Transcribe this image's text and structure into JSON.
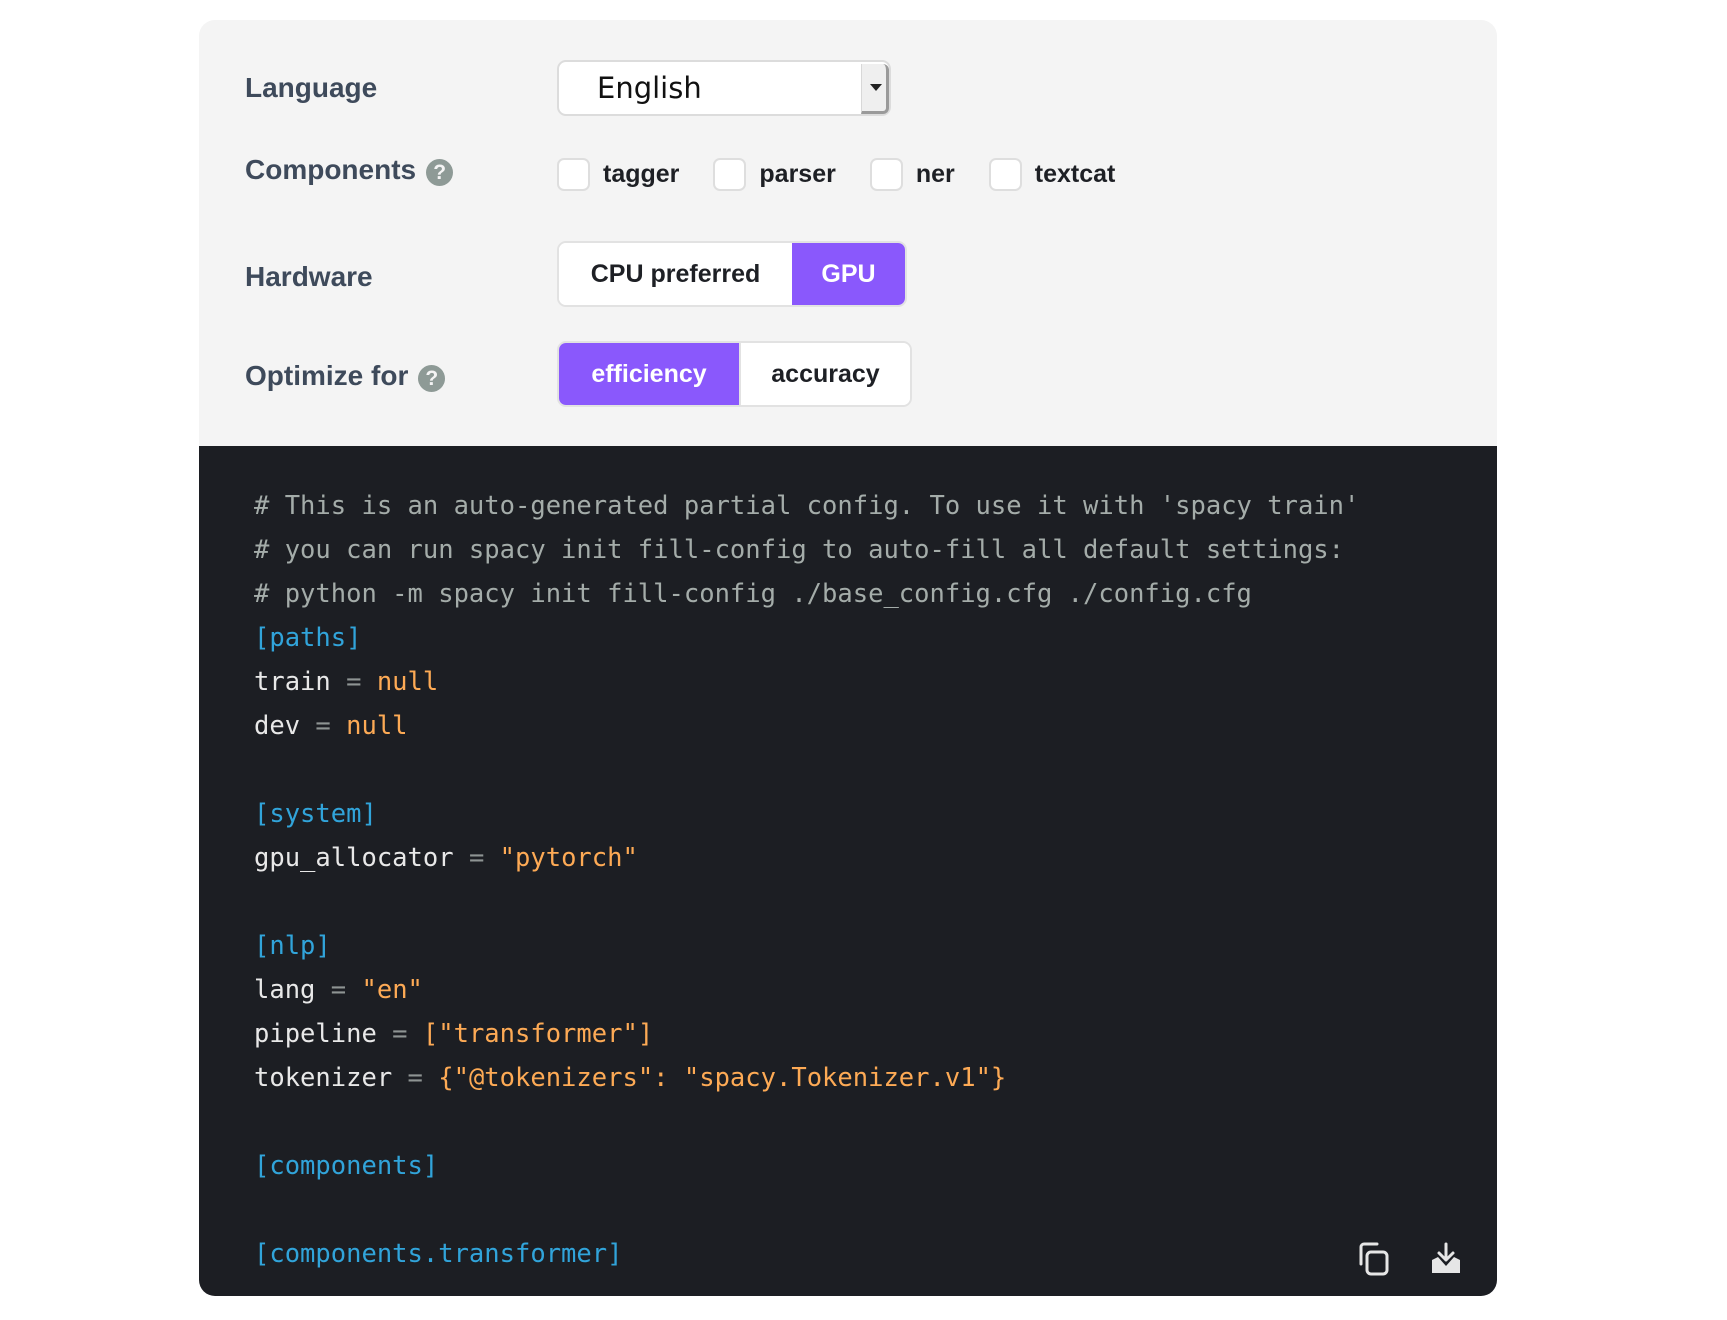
{
  "settings": {
    "language": {
      "label": "Language",
      "value": "English"
    },
    "components": {
      "label": "Components",
      "help_icon": "question-circle-icon",
      "options": [
        {
          "label": "tagger",
          "checked": false
        },
        {
          "label": "parser",
          "checked": false
        },
        {
          "label": "ner",
          "checked": false
        },
        {
          "label": "textcat",
          "checked": false
        }
      ]
    },
    "hardware": {
      "label": "Hardware",
      "options": [
        {
          "label": "CPU preferred",
          "active": false
        },
        {
          "label": "GPU",
          "active": true
        }
      ]
    },
    "optimize": {
      "label": "Optimize for",
      "help_icon": "question-circle-icon",
      "options": [
        {
          "label": "efficiency",
          "active": true
        },
        {
          "label": "accuracy",
          "active": false
        }
      ]
    }
  },
  "code": {
    "lines": [
      [
        {
          "t": "# This is an auto-generated partial config. To use it with 'spacy train'",
          "k": "comment"
        }
      ],
      [
        {
          "t": "# you can run spacy init fill-config to auto-fill all default settings:",
          "k": "comment"
        }
      ],
      [
        {
          "t": "# python -m spacy init fill-config ./base_config.cfg ./config.cfg",
          "k": "comment"
        }
      ],
      [
        {
          "t": "[paths]",
          "k": "section"
        }
      ],
      [
        {
          "t": "train",
          "k": "key"
        },
        {
          "t": " = ",
          "k": "op"
        },
        {
          "t": "null",
          "k": "val"
        }
      ],
      [
        {
          "t": "dev",
          "k": "key"
        },
        {
          "t": " = ",
          "k": "op"
        },
        {
          "t": "null",
          "k": "val"
        }
      ],
      [],
      [
        {
          "t": "[system]",
          "k": "section"
        }
      ],
      [
        {
          "t": "gpu_allocator",
          "k": "key"
        },
        {
          "t": " = ",
          "k": "op"
        },
        {
          "t": "\"pytorch\"",
          "k": "val"
        }
      ],
      [],
      [
        {
          "t": "[nlp]",
          "k": "section"
        }
      ],
      [
        {
          "t": "lang",
          "k": "key"
        },
        {
          "t": " = ",
          "k": "op"
        },
        {
          "t": "\"en\"",
          "k": "val"
        }
      ],
      [
        {
          "t": "pipeline",
          "k": "key"
        },
        {
          "t": " = ",
          "k": "op"
        },
        {
          "t": "[\"transformer\"]",
          "k": "val"
        }
      ],
      [
        {
          "t": "tokenizer",
          "k": "key"
        },
        {
          "t": " = ",
          "k": "op"
        },
        {
          "t": "{\"@tokenizers\": \"spacy.Tokenizer.v1\"}",
          "k": "val"
        }
      ],
      [],
      [
        {
          "t": "[components]",
          "k": "section"
        }
      ],
      [],
      [
        {
          "t": "[components.transformer]",
          "k": "section"
        }
      ]
    ],
    "actions": [
      {
        "name": "copy-icon",
        "label": "Copy"
      },
      {
        "name": "download-icon",
        "label": "Download"
      }
    ]
  },
  "colors": {
    "accent": "#8a58fc",
    "settings_bg": "#f4f4f4",
    "code_bg": "#1c1e23",
    "comment": "#a4aca9",
    "section": "#31a4da",
    "value": "#fdaa55"
  }
}
